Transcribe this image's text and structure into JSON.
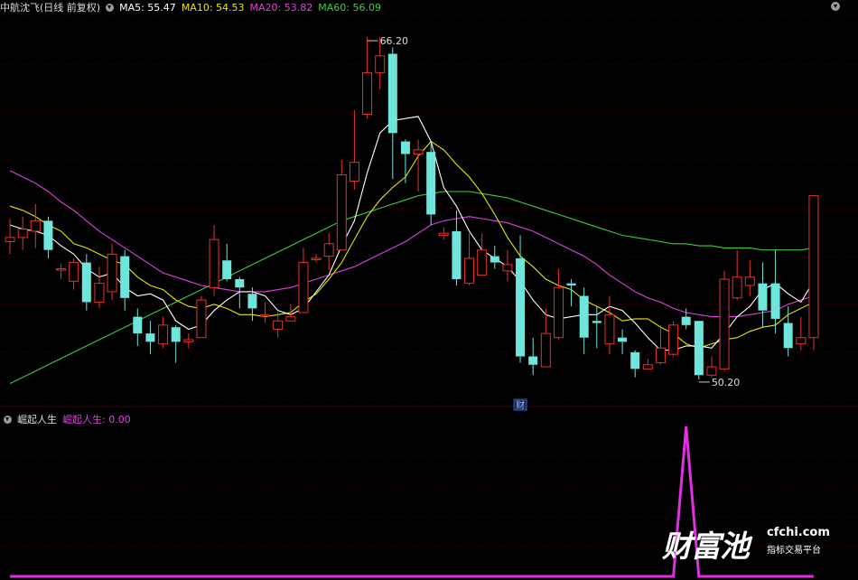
{
  "header": {
    "title": "中航沈飞(日线 前复权)",
    "ma5": "MA5: 55.47",
    "ma10": "MA10: 54.53",
    "ma20": "MA20: 53.82",
    "ma60": "MA60: 56.09"
  },
  "sub_header": {
    "name": "崛起人生",
    "value_label": "崛起人生: 0.00"
  },
  "annotations": {
    "high": "66.20",
    "low": "50.20",
    "caibao": "财"
  },
  "logo": {
    "mark": "财富池",
    "url": "cfchi.com",
    "slogan": "指标交易平台"
  },
  "colors": {
    "up": "#e8302a",
    "down": "#6ee6dc",
    "ma5": "#ffffff",
    "ma10": "#e6e600",
    "ma20": "#e040e0",
    "ma60": "#3ccc3c",
    "indicator": "#e030e0"
  },
  "chart_data": [
    {
      "type": "candlestick",
      "title": "中航沈飞(日线 前复权)",
      "ylim": [
        48.8,
        67.2
      ],
      "grid": true,
      "candles": [
        [
          56.4,
          56.6,
          57.5,
          55.8
        ],
        [
          56.6,
          57.0,
          57.6,
          56.0
        ],
        [
          56.9,
          57.4,
          58.2,
          56.1
        ],
        [
          57.4,
          56.0,
          57.6,
          55.6
        ],
        [
          55.1,
          55.1,
          55.3,
          54.6
        ],
        [
          54.5,
          55.4,
          55.6,
          54.1
        ],
        [
          55.4,
          53.5,
          55.8,
          53.1
        ],
        [
          53.5,
          54.4,
          55.2,
          53.2
        ],
        [
          54.0,
          55.8,
          56.3,
          53.6
        ],
        [
          55.7,
          53.7,
          56.0,
          53.1
        ],
        [
          52.8,
          52.0,
          53.2,
          51.4
        ],
        [
          52.0,
          51.6,
          52.6,
          51.0
        ],
        [
          51.5,
          52.4,
          52.8,
          51.3
        ],
        [
          52.3,
          51.6,
          52.4,
          50.6
        ],
        [
          51.6,
          51.7,
          52.0,
          51.3
        ],
        [
          51.8,
          53.6,
          53.8,
          51.8
        ],
        [
          54.2,
          56.5,
          57.2,
          53.8
        ],
        [
          55.5,
          54.6,
          56.3,
          54.5
        ],
        [
          54.6,
          54.2,
          54.7,
          53.2
        ],
        [
          53.9,
          53.2,
          54.2,
          52.6
        ],
        [
          52.9,
          52.9,
          53.5,
          52.5
        ],
        [
          52.2,
          52.6,
          53.0,
          51.8
        ],
        [
          52.6,
          52.8,
          53.4,
          52.6
        ],
        [
          53.0,
          55.4,
          56.1,
          53.0
        ],
        [
          55.6,
          55.6,
          55.8,
          55.4
        ],
        [
          55.7,
          56.3,
          56.8,
          55.0
        ],
        [
          56.0,
          59.6,
          60.3,
          56.0
        ],
        [
          59.3,
          60.2,
          62.7,
          58.9
        ],
        [
          62.5,
          64.5,
          66.2,
          62.3
        ],
        [
          64.5,
          65.3,
          66.2,
          63.7
        ],
        [
          65.4,
          61.6,
          65.7,
          59.4
        ],
        [
          61.2,
          60.6,
          61.3,
          59.2
        ],
        [
          60.6,
          60.8,
          61.3,
          58.8
        ],
        [
          60.7,
          57.7,
          61.1,
          57.2
        ],
        [
          56.7,
          56.8,
          57.1,
          56.5
        ],
        [
          56.9,
          54.6,
          57.9,
          54.3
        ],
        [
          54.4,
          55.6,
          56.8,
          54.3
        ],
        [
          54.8,
          56.0,
          56.8,
          55.2
        ],
        [
          55.7,
          55.4,
          56.2,
          55.1
        ],
        [
          55.0,
          55.3,
          56.0,
          54.5
        ],
        [
          55.6,
          50.9,
          56.7,
          50.6
        ],
        [
          50.9,
          50.5,
          51.8,
          50.0
        ],
        [
          50.4,
          52.0,
          53.2,
          50.4
        ],
        [
          51.8,
          54.2,
          55.1,
          51.7
        ],
        [
          54.4,
          54.3,
          54.6,
          53.3
        ],
        [
          53.8,
          51.8,
          54.2,
          51.0
        ],
        [
          52.6,
          52.5,
          53.3,
          51.3
        ],
        [
          51.5,
          52.9,
          53.8,
          51.0
        ],
        [
          51.8,
          51.6,
          52.2,
          51.0
        ],
        [
          51.1,
          50.3,
          51.2,
          49.9
        ],
        [
          50.3,
          50.5,
          50.8,
          50.3
        ],
        [
          50.6,
          51.3,
          52.4,
          50.5
        ],
        [
          51.0,
          52.4,
          52.6,
          50.9
        ],
        [
          52.8,
          52.4,
          53.2,
          52.2
        ],
        [
          52.6,
          50.0,
          52.6,
          49.8
        ],
        [
          50.0,
          50.4,
          50.9,
          49.9
        ],
        [
          50.3,
          54.6,
          55.0,
          50.2
        ],
        [
          53.7,
          54.7,
          56.0,
          53.6
        ],
        [
          54.3,
          54.7,
          55.5,
          53.8
        ],
        [
          54.4,
          53.1,
          55.4,
          52.3
        ],
        [
          54.4,
          52.7,
          56.0,
          52.0
        ],
        [
          52.5,
          51.3,
          53.3,
          50.9
        ],
        [
          51.5,
          51.8,
          52.8,
          51.2
        ],
        [
          51.8,
          58.6,
          58.6,
          51.2
        ]
      ],
      "ma5": [
        57.2,
        57.0,
        56.9,
        56.7,
        56.2,
        55.8,
        55.1,
        54.7,
        54.9,
        54.2,
        53.8,
        53.9,
        53.6,
        52.6,
        52.2,
        52.4,
        53.1,
        53.6,
        54.0,
        54.0,
        53.8,
        53.1,
        52.9,
        53.2,
        54.0,
        54.8,
        56.2,
        57.4,
        59.7,
        61.6,
        62.2,
        62.3,
        62.4,
        61.2,
        59.0,
        58.1,
        56.9,
        56.0,
        55.6,
        55.2,
        54.5,
        53.6,
        52.9,
        52.7,
        52.8,
        52.9,
        52.9,
        53.3,
        53.1,
        52.5,
        51.8,
        51.2,
        51.2,
        51.4,
        51.4,
        51.3,
        52.0,
        52.8,
        53.3,
        54.1,
        54.4,
        53.9,
        53.5,
        54.5
      ],
      "ma10": [
        58.1,
        57.9,
        57.6,
        57.2,
        56.9,
        56.3,
        56.1,
        55.8,
        55.5,
        55.3,
        54.7,
        54.3,
        54.1,
        53.6,
        53.3,
        53.2,
        53.4,
        53.2,
        52.9,
        52.9,
        52.8,
        52.9,
        53.0,
        53.5,
        53.9,
        54.6,
        55.4,
        56.5,
        57.6,
        58.4,
        59.0,
        59.5,
        60.5,
        61.2,
        60.8,
        60.1,
        59.5,
        58.7,
        57.7,
        56.6,
        55.7,
        55.2,
        54.6,
        54.3,
        54.1,
        53.6,
        53.3,
        53.0,
        52.6,
        52.7,
        52.7,
        52.3,
        52.0,
        51.5,
        51.3,
        51.5,
        51.7,
        51.8,
        52.1,
        52.3,
        52.4,
        52.9,
        53.2,
        53.5
      ],
      "ma20": [
        59.8,
        59.5,
        59.2,
        58.8,
        58.3,
        57.9,
        57.4,
        56.9,
        56.5,
        56.1,
        55.7,
        55.3,
        54.9,
        54.7,
        54.5,
        54.3,
        54.2,
        54.1,
        54.0,
        54.0,
        54.0,
        54.1,
        54.2,
        54.4,
        54.6,
        54.8,
        55.0,
        55.2,
        55.5,
        55.8,
        56.1,
        56.4,
        56.8,
        57.2,
        57.4,
        57.5,
        57.6,
        57.5,
        57.4,
        57.3,
        57.1,
        56.9,
        56.6,
        56.3,
        56.0,
        55.7,
        55.3,
        54.8,
        54.4,
        54.0,
        53.7,
        53.5,
        53.2,
        53.0,
        52.9,
        52.8,
        52.8,
        52.8,
        52.9,
        53.0,
        53.1,
        53.4,
        53.6,
        53.8
      ],
      "ma60": [
        49.6,
        49.9,
        50.2,
        50.5,
        50.8,
        51.1,
        51.4,
        51.7,
        52.0,
        52.3,
        52.6,
        52.9,
        53.2,
        53.5,
        53.8,
        54.1,
        54.4,
        54.7,
        55.0,
        55.3,
        55.6,
        55.9,
        56.2,
        56.5,
        56.8,
        57.1,
        57.4,
        57.6,
        57.8,
        58.0,
        58.2,
        58.4,
        58.6,
        58.7,
        58.8,
        58.8,
        58.8,
        58.7,
        58.6,
        58.5,
        58.3,
        58.1,
        57.9,
        57.7,
        57.5,
        57.3,
        57.1,
        56.9,
        56.7,
        56.6,
        56.5,
        56.4,
        56.3,
        56.3,
        56.2,
        56.2,
        56.1,
        56.1,
        56.1,
        56.0,
        56.0,
        56.0,
        56.0,
        56.1
      ]
    },
    {
      "type": "line",
      "series": [
        {
          "name": "崛起人生",
          "values": [
            0,
            0,
            0,
            0,
            0,
            0,
            0,
            0,
            0,
            0,
            0,
            0,
            0,
            0,
            0,
            0,
            0,
            0,
            0,
            0,
            0,
            0,
            0,
            0,
            0,
            0,
            0,
            0,
            0,
            0,
            0,
            0,
            0,
            0,
            0,
            0,
            0,
            0,
            0,
            0,
            0,
            0,
            0,
            0,
            0,
            0,
            0,
            0,
            0,
            0,
            0,
            0,
            0,
            1,
            0,
            0,
            0,
            0,
            0,
            0,
            0,
            0,
            0,
            0
          ]
        }
      ],
      "ylim": [
        0,
        1
      ]
    }
  ]
}
